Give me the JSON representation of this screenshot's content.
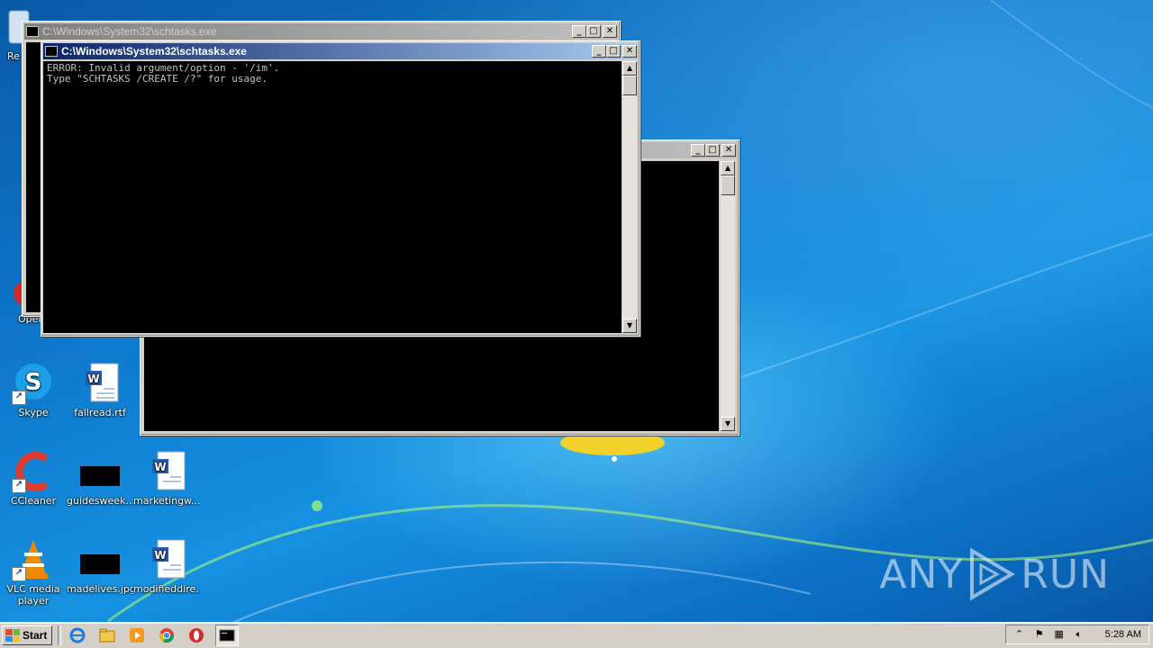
{
  "desktop": {
    "icons": [
      {
        "label": "Skype"
      },
      {
        "label": "fallread.rtf"
      },
      {
        "label": "CCleaner"
      },
      {
        "label": "guidesweek..."
      },
      {
        "label": "marketingw..."
      },
      {
        "label": "VLC media player"
      },
      {
        "label": "madelives.jpg"
      },
      {
        "label": "modifieddire..."
      },
      {
        "label": "Re"
      },
      {
        "label": "Oper"
      }
    ]
  },
  "windows": {
    "back": {
      "title": "C:\\Windows\\System32\\schtasks.exe"
    },
    "front": {
      "title": "C:\\Windows\\System32\\schtasks.exe",
      "console_lines": [
        "ERROR: Invalid argument/option - '/im'.",
        "Type \"SCHTASKS /CREATE /?\" for usage."
      ]
    },
    "buttons": {
      "minimize": "_",
      "maximize": "□",
      "close": "✕"
    }
  },
  "watermark": {
    "left": "ANY",
    "right": "RUN"
  },
  "taskbar": {
    "start_label": "Start",
    "quick_launch": [
      "ie-icon",
      "explorer-icon",
      "media-player-icon",
      "chrome-icon",
      "opera-icon",
      "console-icon"
    ],
    "clock": "5:28 AM"
  },
  "colors": {
    "desktop_blue": "#0e78cc",
    "title_active": "#0a246a",
    "title_inactive": "#808080",
    "window_face": "#d4d0c8"
  }
}
